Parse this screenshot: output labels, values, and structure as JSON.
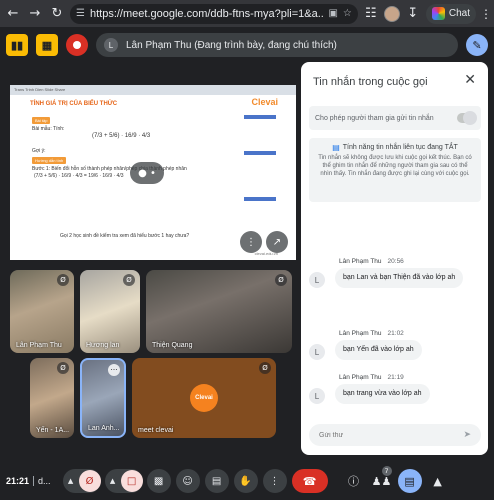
{
  "browser": {
    "url": "https://meet.google.com/ddb-ftns-mya?pli=1&a...",
    "chat_label": "Chat"
  },
  "presenter": {
    "initial": "L",
    "label": "Lân Phạm Thu (Đang trình bày, đang chú thích)"
  },
  "slide": {
    "header": "Trans Trinh Dien Slide Share",
    "title": "TÍNH GIÁ TRỊ CỦA BIỂU THỨC",
    "logo": "Clevai",
    "tag1": "Bài tập",
    "bai_mau": "Bài mẫu:  Tính:",
    "expr1": "(7/3 + 5/6) · 16/9 · 4/3",
    "goi_y": "Gợi ý:",
    "tag2": "Hướng dẫn tính",
    "step1": "Bước 1: Biến đổi hỗn số thành phép nhân/phép chia thành phép nhân",
    "expr2": "(7/3 + 5/6) · 16/9 · 4/3 = 19/6 · 16/9 · 4/3",
    "question": "Gọi 2 học sinh đề kiểm tra xem đã hiểu bước 1 hay chưa?",
    "footer": "clevai.edu.vn"
  },
  "participants": [
    {
      "name": "Lân Phạm Thu"
    },
    {
      "name": "Hương lan"
    },
    {
      "name": "Thiện Quang"
    },
    {
      "name": "Yến - 1A..."
    },
    {
      "name": "Lan Anh..."
    },
    {
      "name": "meet clevai",
      "logo": "Clevai"
    }
  ],
  "chat": {
    "title": "Tin nhắn trong cuộc gọi",
    "toggle_label": "Cho phép người tham gia gửi tin nhắn",
    "info_title": "Tính năng tin nhắn liên tục đang TẮT",
    "info_body": "Tin nhắn sẽ không được lưu khi cuộc gọi kết thúc. Bạn có thể ghim tin nhắn để những người tham gia sau có thể nhìn thấy. Tin nhắn đang được ghi lại cùng với cuộc gọi.",
    "messages": [
      {
        "sender": "Lân Phạm Thu",
        "time": "20:56",
        "initial": "L",
        "text": "bạn Lan và bạn Thiện đã vào lớp ah"
      },
      {
        "sender": "Lân Phạm Thu",
        "time": "21:02",
        "initial": "L",
        "text": "bạn Yến đã vào lớp ah"
      },
      {
        "sender": "Lân Phạm Thu",
        "time": "21:19",
        "initial": "L",
        "text": "bạn trang vừa vào lớp  ah"
      }
    ],
    "input_placeholder": "Gửi thư"
  },
  "bottom": {
    "clock": "21:21",
    "meeting_code": "d...",
    "people_count": "7"
  }
}
